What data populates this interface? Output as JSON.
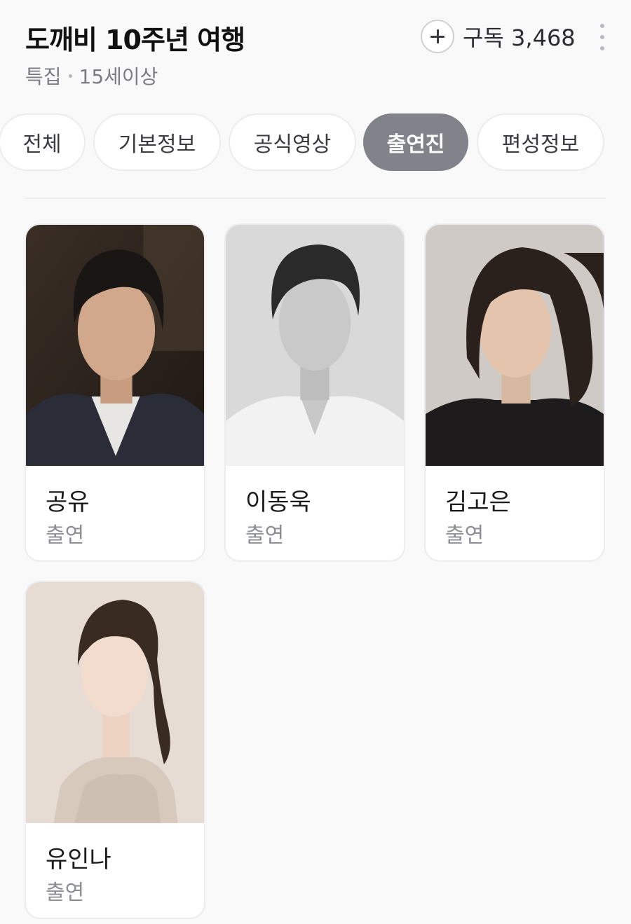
{
  "header": {
    "title": "도깨비 10주년 여행",
    "category": "특집",
    "rating": "15세이상",
    "subscribe_label": "구독 3,468"
  },
  "tabs": [
    {
      "label": "전체",
      "active": false
    },
    {
      "label": "기본정보",
      "active": false
    },
    {
      "label": "공식영상",
      "active": false
    },
    {
      "label": "출연진",
      "active": true
    },
    {
      "label": "편성정보",
      "active": false
    }
  ],
  "cast": [
    {
      "name": "공유",
      "role": "출연"
    },
    {
      "name": "이동욱",
      "role": "출연"
    },
    {
      "name": "김고은",
      "role": "출연"
    },
    {
      "name": "유인나",
      "role": "출연"
    }
  ],
  "colors": {
    "active_tab": "#80838a",
    "border": "#ececee",
    "muted_text": "#8c8e93"
  }
}
